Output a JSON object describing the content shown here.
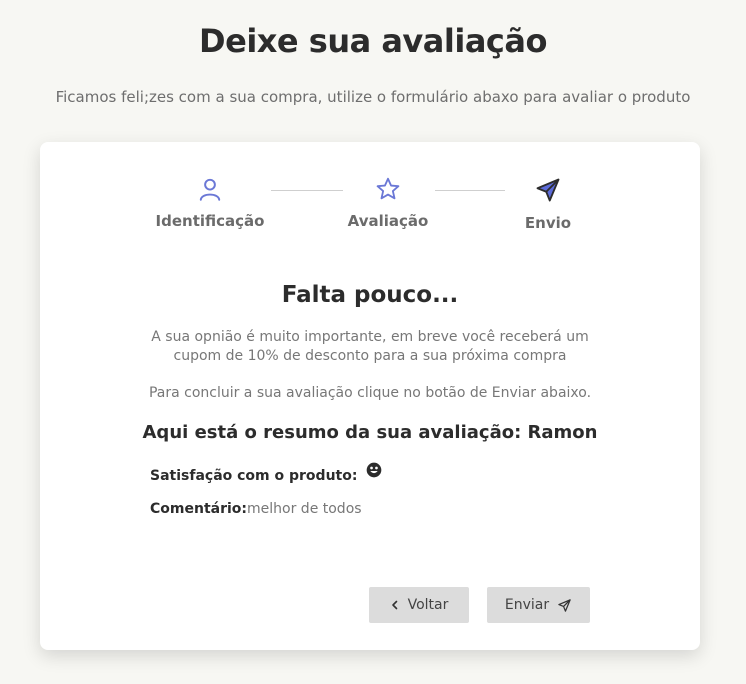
{
  "header": {
    "title": "Deixe sua avaliação",
    "subtitle": "Ficamos feli;zes com a sua compra, utilize o formulário abaxo para avaliar o produto"
  },
  "steps": [
    {
      "label": "Identificação",
      "icon": "user-icon"
    },
    {
      "label": "Avaliação",
      "icon": "star-icon"
    },
    {
      "label": "Envio",
      "icon": "send-icon"
    }
  ],
  "content": {
    "title": "Falta pouco...",
    "message": "A sua opnião é muito importante, em breve você receberá um cupom de 10% de desconto para a sua próxima compra",
    "instruction": "Para concluir a sua avaliação clique no botão de Enviar abaixo.",
    "summary_heading": "Aqui está o resumo da sua avaliação: Ramon",
    "satisfaction_label": "Satisfação com o produto:",
    "satisfaction_icon": "happy-face-icon",
    "comment_label": "Comentário:",
    "comment_value": "melhor de todos"
  },
  "buttons": {
    "back_label": "Voltar",
    "send_label": "Enviar"
  },
  "colors": {
    "accent": "#6b78d6",
    "send_fill": "#5c6bd9"
  }
}
